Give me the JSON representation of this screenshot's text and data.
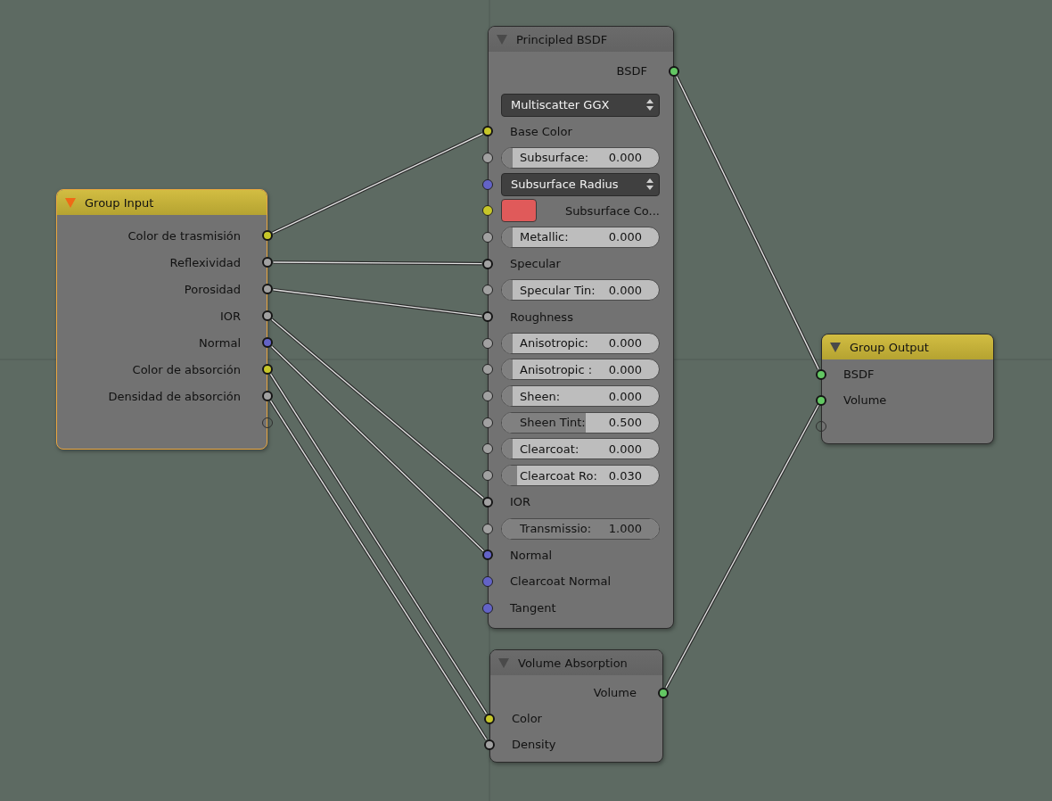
{
  "nodes": [
    {
      "title": "Group Input",
      "kind": "group",
      "selected": true,
      "rows": [
        {
          "kind": "output",
          "label": "Color de trasmisión",
          "color": "#c7c729",
          "linked": true
        },
        {
          "kind": "output",
          "label": "Reflexividad",
          "color": "#a1a1a1",
          "linked": true
        },
        {
          "kind": "output",
          "label": "Porosidad",
          "color": "#a1a1a1",
          "linked": true
        },
        {
          "kind": "output",
          "label": "IOR",
          "color": "#a1a1a1",
          "linked": true
        },
        {
          "kind": "output",
          "label": "Normal",
          "color": "#6363c7",
          "linked": true
        },
        {
          "kind": "output",
          "label": "Color de absorción",
          "color": "#c7c729",
          "linked": true
        },
        {
          "kind": "output",
          "label": "Densidad de absorción",
          "color": "#a1a1a1",
          "linked": true
        },
        {
          "kind": "output"
        }
      ]
    },
    {
      "title": "Principled BSDF",
      "kind": "shader",
      "selected": false,
      "rows": [
        {
          "kind": "output",
          "label": "BSDF",
          "color": "#63c763",
          "linked": true
        },
        {
          "kind": "menu",
          "label": "Multiscatter GGX"
        },
        {
          "kind": "input",
          "label": "Base Color",
          "color": "#c7c729",
          "linked": true
        },
        {
          "kind": "slider",
          "label": "Subsurface:",
          "value": "0.000",
          "level": 0,
          "color": "#a1a1a1"
        },
        {
          "kind": "menu",
          "label": "Subsurface Radius",
          "color": "#6363c7"
        },
        {
          "kind": "swatch",
          "label": "Subsurface Co...",
          "swatch": {
            "color": "#e05a5a"
          },
          "color": "#c7c729"
        },
        {
          "kind": "slider",
          "label": "Metallic:",
          "value": "0.000",
          "level": 0,
          "color": "#a1a1a1"
        },
        {
          "kind": "input",
          "label": "Specular",
          "color": "#a1a1a1",
          "linked": true
        },
        {
          "kind": "slider",
          "label": "Specular Tin:",
          "value": "0.000",
          "level": 0,
          "color": "#a1a1a1"
        },
        {
          "kind": "input",
          "label": "Roughness",
          "color": "#a1a1a1",
          "linked": true
        },
        {
          "kind": "slider",
          "label": "Anisotropic:",
          "value": "0.000",
          "level": 0,
          "color": "#a1a1a1"
        },
        {
          "kind": "slider",
          "label": "Anisotropic :",
          "value": "0.000",
          "level": 0,
          "color": "#a1a1a1"
        },
        {
          "kind": "slider",
          "label": "Sheen:",
          "value": "0.000",
          "level": 0,
          "color": "#a1a1a1"
        },
        {
          "kind": "slider",
          "label": "Sheen Tint:",
          "value": "0.500",
          "level": 0.5,
          "color": "#a1a1a1"
        },
        {
          "kind": "slider",
          "label": "Clearcoat:",
          "value": "0.000",
          "level": 0,
          "color": "#a1a1a1"
        },
        {
          "kind": "slider",
          "label": "Clearcoat Ro:",
          "value": "0.030",
          "level": 0.03,
          "color": "#a1a1a1"
        },
        {
          "kind": "input",
          "label": "IOR",
          "color": "#a1a1a1",
          "linked": true
        },
        {
          "kind": "slider",
          "label": "Transmissio:",
          "value": "1.000",
          "level": 1,
          "color": "#a1a1a1"
        },
        {
          "kind": "input",
          "label": "Normal",
          "color": "#6363c7",
          "linked": true
        },
        {
          "kind": "input",
          "label": "Clearcoat Normal",
          "color": "#6363c7"
        },
        {
          "kind": "input",
          "label": "Tangent",
          "color": "#6363c7"
        }
      ]
    },
    {
      "title": "Volume Absorption",
      "kind": "shader",
      "selected": false,
      "rows": [
        {
          "kind": "output",
          "label": "Volume",
          "color": "#63c763",
          "linked": true
        },
        {
          "kind": "input",
          "label": "Color",
          "color": "#c7c729",
          "linked": true
        },
        {
          "kind": "input",
          "label": "Density",
          "color": "#a1a1a1",
          "linked": true
        }
      ]
    },
    {
      "title": "Group Output",
      "kind": "group",
      "selected": false,
      "rows": [
        {
          "kind": "input",
          "label": "BSDF",
          "color": "#63c763",
          "linked": true
        },
        {
          "kind": "input",
          "label": "Volume",
          "color": "#63c763",
          "linked": true
        },
        {
          "kind": "input"
        }
      ]
    }
  ]
}
